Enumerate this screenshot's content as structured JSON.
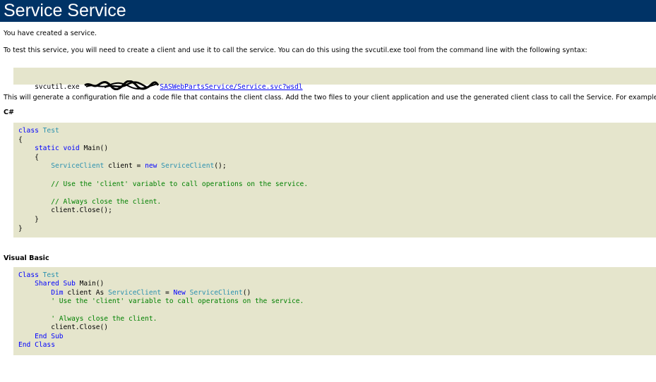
{
  "header": {
    "title": "Service Service"
  },
  "intro": {
    "created": "You have created a service.",
    "test_instructions": "To test this service, you will need to create a client and use it to call the service. You can do this using the svcutil.exe tool from the command line with the following syntax:"
  },
  "command": {
    "prefix": "svcutil.exe ",
    "url_visible": "SASWebPartsService/Service.svc?wsdl"
  },
  "generate_text": "This will generate a configuration file and a code file that contains the client class. Add the two files to your client application and use the generated client class to call the Service. For example:",
  "csharp": {
    "heading": "C#",
    "lines": [
      [
        {
          "t": "class ",
          "c": "kw"
        },
        {
          "t": "Test",
          "c": "ty"
        }
      ],
      [
        {
          "t": "{",
          "c": ""
        }
      ],
      [
        {
          "t": "    static ",
          "c": "kw"
        },
        {
          "t": "void ",
          "c": "kw"
        },
        {
          "t": "Main()",
          "c": ""
        }
      ],
      [
        {
          "t": "    {",
          "c": ""
        }
      ],
      [
        {
          "t": "        ServiceClient",
          "c": "ty"
        },
        {
          "t": " client = ",
          "c": ""
        },
        {
          "t": "new ",
          "c": "kw"
        },
        {
          "t": "ServiceClient",
          "c": "ty"
        },
        {
          "t": "();",
          "c": ""
        }
      ],
      [
        {
          "t": "",
          "c": ""
        }
      ],
      [
        {
          "t": "        // Use the 'client' variable to call operations on the service.",
          "c": "cm"
        }
      ],
      [
        {
          "t": "",
          "c": ""
        }
      ],
      [
        {
          "t": "        // Always close the client.",
          "c": "cm"
        }
      ],
      [
        {
          "t": "        client.Close();",
          "c": ""
        }
      ],
      [
        {
          "t": "    }",
          "c": ""
        }
      ],
      [
        {
          "t": "}",
          "c": ""
        }
      ]
    ]
  },
  "vb": {
    "heading": "Visual Basic",
    "lines": [
      [
        {
          "t": "Class ",
          "c": "kw"
        },
        {
          "t": "Test",
          "c": "ty"
        }
      ],
      [
        {
          "t": "    Shared ",
          "c": "kw"
        },
        {
          "t": "Sub ",
          "c": "kw"
        },
        {
          "t": "Main()",
          "c": ""
        }
      ],
      [
        {
          "t": "        Dim ",
          "c": "kw"
        },
        {
          "t": "client ",
          "c": ""
        },
        {
          "t": "As ",
          "c": ""
        },
        {
          "t": "ServiceClient",
          "c": "ty"
        },
        {
          "t": " = ",
          "c": ""
        },
        {
          "t": "New ",
          "c": "kw"
        },
        {
          "t": "ServiceClient",
          "c": "ty"
        },
        {
          "t": "()",
          "c": ""
        }
      ],
      [
        {
          "t": "        ' Use the 'client' variable to call operations on the service.",
          "c": "cm"
        }
      ],
      [
        {
          "t": "",
          "c": ""
        }
      ],
      [
        {
          "t": "        ' Always close the client.",
          "c": "cm"
        }
      ],
      [
        {
          "t": "        client.Close()",
          "c": ""
        }
      ],
      [
        {
          "t": "    End Sub",
          "c": "kw"
        }
      ],
      [
        {
          "t": "End Class",
          "c": "kw"
        }
      ]
    ]
  }
}
